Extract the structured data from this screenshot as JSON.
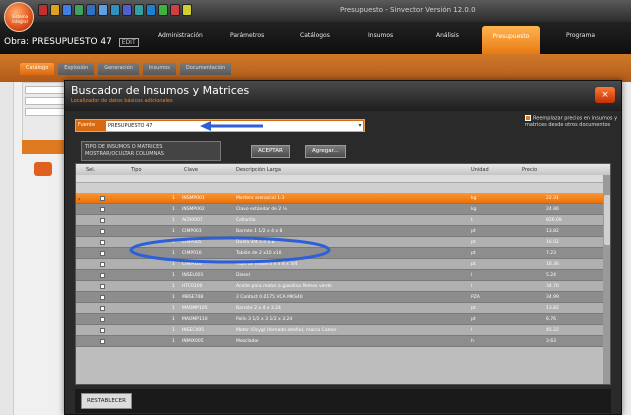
{
  "app": {
    "title": "Presupuesto - Sinvector Versión 12.0.0",
    "logo_line1": "Sistema",
    "logo_line2": "Integral"
  },
  "header": {
    "document_title": "Obra: PRESUPUESTO 47",
    "document_tag": "EDIT"
  },
  "menu": {
    "items": [
      {
        "label": "Administración"
      },
      {
        "label": "Parámetros"
      },
      {
        "label": "Catálogos"
      },
      {
        "label": "Insumos"
      },
      {
        "label": "Análisis"
      },
      {
        "label": "Presupuesto"
      },
      {
        "label": "Programa"
      }
    ],
    "active_index": 5
  },
  "subtabs": [
    "Catálogo",
    "Explosión",
    "Generación",
    "Insumos",
    "Documentación"
  ],
  "dialog": {
    "title": "Buscador de Insumos y Matrices",
    "subtitle": "Localizador de datos básicos adicionales",
    "close_glyph": "×",
    "fuente_label": "Fuente",
    "fuente_value": "PRESUPUESTO 47",
    "fuente_arrow": "▾",
    "replace_text": "Reemplazar precios en insumos y matrices desde otros documentos",
    "tipo_box_line1": "TIPO DE INSUMOS O MATRICES",
    "tipo_box_line2": "MOSTRAR/OCULTAR COLUMNAS",
    "accept_label": "ACEPTAR",
    "add_label": "Agregar...",
    "restablecer_label": "RESTABLECER",
    "columns": {
      "sel": "Sel.",
      "tipo": "Tipo",
      "clave": "Clave",
      "desc": "Descripción Larga",
      "unidad": "Unidad",
      "precio": "Precio"
    },
    "rows": [
      {
        "tipo": "1",
        "clave": "INSMP001",
        "desc": "Mortero arena/cal 1:3",
        "unidad": "kg",
        "precio": "22.31"
      },
      {
        "tipo": "1",
        "clave": "INSMP002",
        "desc": "Clavo estándar de 2 ½",
        "unidad": "kg",
        "precio": "24.86"
      },
      {
        "tipo": "1",
        "clave": "ACR0007",
        "desc": "Cellarilla",
        "unidad": "t",
        "precio": "826.09"
      },
      {
        "tipo": "1",
        "clave": "CIMP003",
        "desc": "Barrote 1 1/2 x 4 x 8",
        "unidad": "pt",
        "precio": "13.82"
      },
      {
        "tipo": "1",
        "clave": "CIMP005",
        "desc": "Duela 3/4 x 4 x 8",
        "unidad": "pt",
        "precio": "16.02"
      },
      {
        "tipo": "1",
        "clave": "CIMP010",
        "desc": "Tablón de 2 x10 x10",
        "unidad": "pt",
        "precio": "7.23"
      },
      {
        "tipo": "1",
        "clave": "CIMP010",
        "desc": "Hoja de madera 4 x 8 x 3/4",
        "unidad": "pt",
        "precio": "16.36"
      },
      {
        "tipo": "1",
        "clave": "INSEL001",
        "desc": "Diesel",
        "unidad": "l",
        "precio": "5.24"
      },
      {
        "tipo": "1",
        "clave": "HTC0100",
        "desc": "Aceite para motor a gasolina Pemex verde",
        "unidad": "l",
        "precio": "34.70"
      },
      {
        "tipo": "1",
        "clave": "MBSE708",
        "desc": "2 Contact 0.0175 VCA MKS40",
        "unidad": "PZA",
        "precio": "34.99"
      },
      {
        "tipo": "1",
        "clave": "MAOMP105",
        "desc": "Barrote 2 x 4 x 3.24",
        "unidad": "pt",
        "precio": "13.82"
      },
      {
        "tipo": "1",
        "clave": "MAOMP110",
        "desc": "Polín 3 1/2 x 3 1/2 x 3.24",
        "unidad": "pt",
        "precio": "6.76"
      },
      {
        "tipo": "1",
        "clave": "INSEC005",
        "desc": "Motor (Ocyg) (tomado alteño), marca Camer",
        "unidad": "l",
        "precio": "45.22"
      },
      {
        "tipo": "1",
        "clave": "INMIX005",
        "desc": "Mezclador",
        "unidad": "h",
        "precio": "3.63"
      }
    ]
  },
  "colors": {
    "accent": "#e8720c",
    "highlight": "#2d5fd8",
    "dialog_bg": "#2a2a2a"
  }
}
